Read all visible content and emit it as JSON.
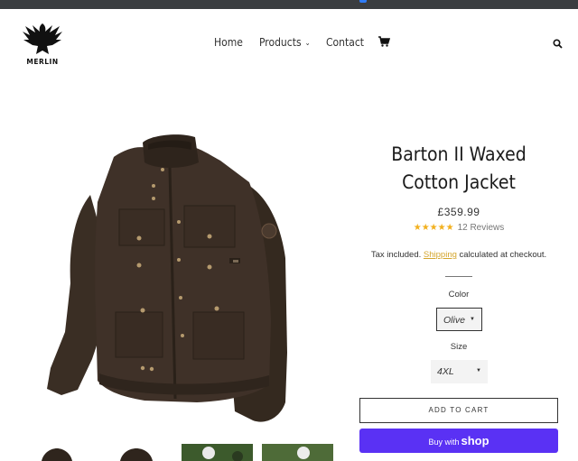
{
  "brand": {
    "name": "MERLIN"
  },
  "nav": {
    "home": "Home",
    "products": "Products",
    "contact": "Contact"
  },
  "product": {
    "title": "Barton II Waxed Cotton Jacket",
    "price": "£359.99",
    "rating_stars": "★★★★★",
    "reviews": "12 Reviews",
    "tax_prefix": "Tax included.",
    "tax_link": "Shipping",
    "tax_suffix": "calculated at checkout."
  },
  "options": {
    "color_label": "Color",
    "color_value": "Olive",
    "size_label": "Size",
    "size_value": "4XL"
  },
  "buttons": {
    "add_to_cart": "ADD TO CART",
    "buy_with": "Buy with",
    "shop": "shop"
  },
  "colors": {
    "accent_link": "#d4a52c",
    "star": "#f2b01e",
    "shop_pay": "#5a31f4",
    "jacket": "#3f3128"
  }
}
